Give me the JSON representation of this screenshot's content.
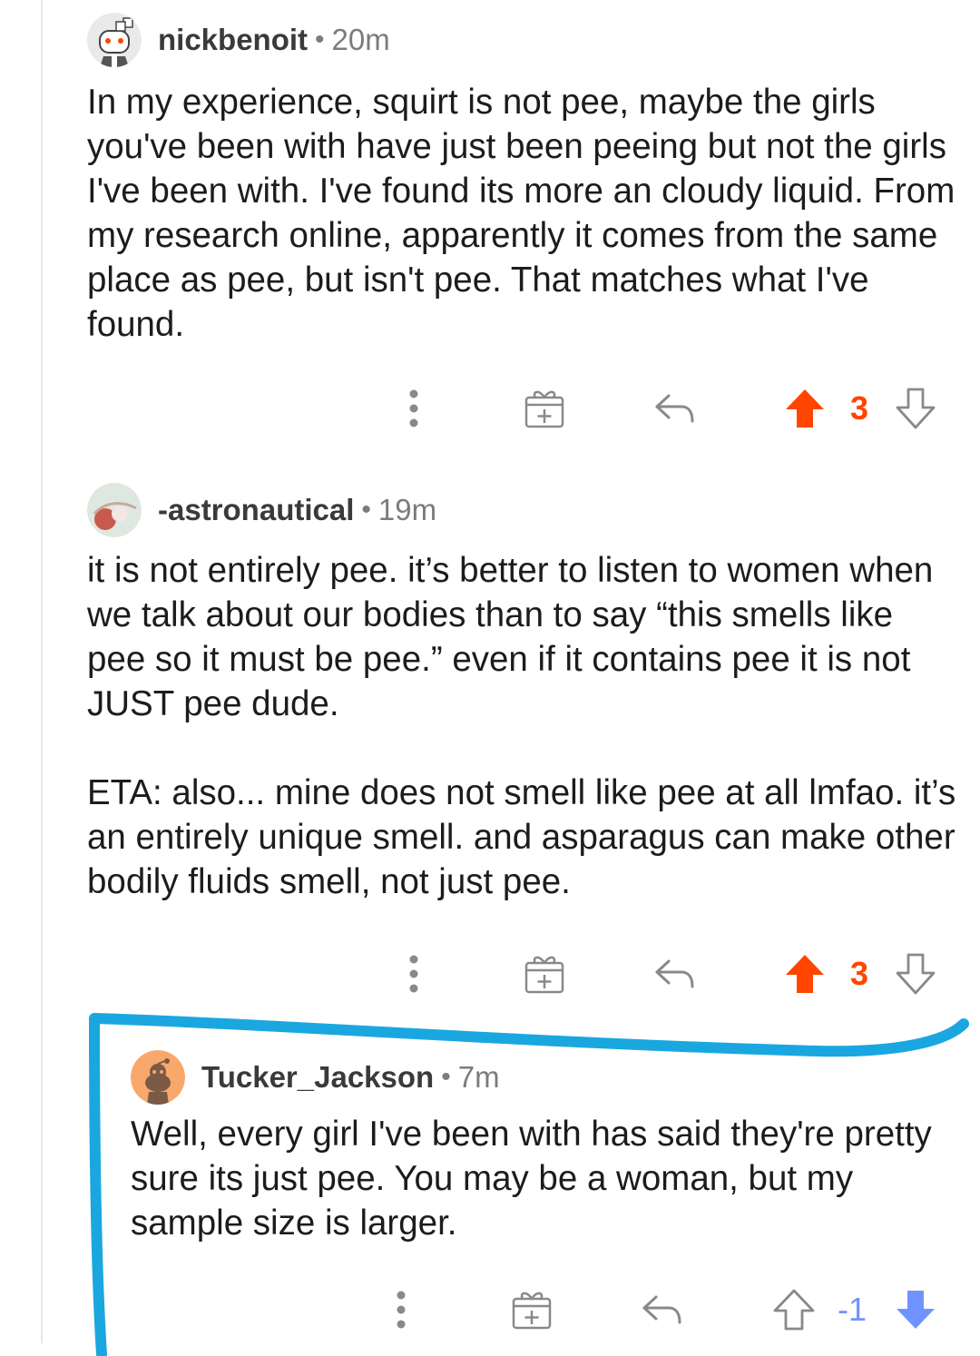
{
  "comments": [
    {
      "username": "nickbenoit",
      "separator": "•",
      "time": "20m",
      "paragraphs": [
        "In my experience, squirt is not pee, maybe the girls you've been with have just been peeing but not the girls I've been with. I've found its more an cloudy liquid. From my research online, apparently it comes from the same place as pee, but isn't pee. That matches what I've found."
      ],
      "score": "3",
      "vote_state": "upvoted",
      "icons": [
        "more-options-icon",
        "award-icon",
        "reply-icon",
        "upvote-icon",
        "downvote-icon"
      ]
    },
    {
      "username": "-astronautical",
      "separator": "•",
      "time": "19m",
      "paragraphs": [
        "it is not entirely pee. it’s better to listen to women when we talk about our bodies than to say “this smells like pee so it must be pee.” even if it contains pee it is not JUST pee dude.",
        "ETA: also... mine does not smell like pee at all lmfao. it’s an entirely unique smell. and asparagus can make other bodily fluids smell, not just pee."
      ],
      "score": "3",
      "vote_state": "upvoted"
    },
    {
      "username": "Tucker_Jackson",
      "separator": "•",
      "time": "7m",
      "paragraphs": [
        "Well, every girl I've been with has said they're pretty sure its just pee. You may be a woman, but my sample size is larger."
      ],
      "score": "-1",
      "vote_state": "downvoted"
    }
  ],
  "colors": {
    "upvote": "#ff4500",
    "downvote": "#7193ff",
    "icon_gray": "#878a8c",
    "highlight_marker": "#1aa7e0"
  }
}
